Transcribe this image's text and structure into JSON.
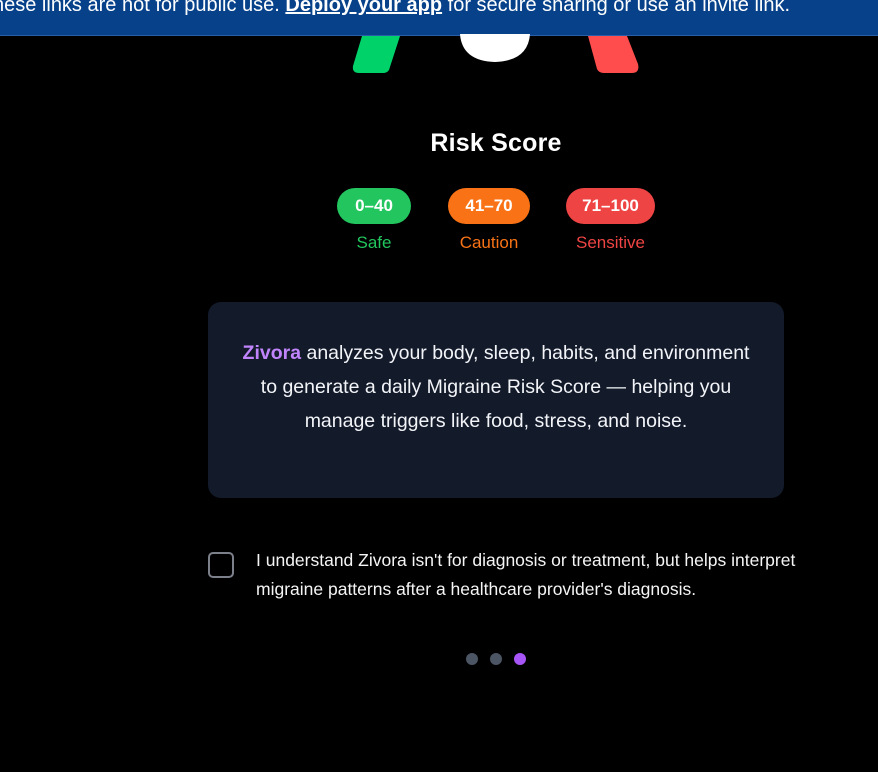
{
  "banner": {
    "text_before": "hese links are not for public use. ",
    "link_label": "Deploy your app",
    "text_after": " for secure sharing or use an invite link."
  },
  "gauge": {
    "colors": {
      "left_segment": "#00d26a",
      "center_knob": "#ffffff",
      "right_segment": "#ff4d4d"
    }
  },
  "risk": {
    "title": "Risk Score",
    "ranges": [
      {
        "range": "0–40",
        "label": "Safe",
        "color": "#22c55e",
        "label_color": "#22c55e"
      },
      {
        "range": "41–70",
        "label": "Caution",
        "color": "#f97316",
        "label_color": "#f97316"
      },
      {
        "range": "71–100",
        "label": "Sensitive",
        "color": "#ef4444",
        "label_color": "#ef4444"
      }
    ]
  },
  "info": {
    "brand": "Zivora",
    "text": " analyzes your body, sleep, habits, and environment to generate a daily Migraine Risk Score — helping you manage triggers like food, stress, and noise."
  },
  "consent": {
    "checked": false,
    "text": "I understand Zivora isn't for diagnosis or treatment, but helps interpret migraine patterns after a healthcare provider's diagnosis."
  },
  "pagination": {
    "total": 3,
    "active_index": 2,
    "colors": {
      "inactive": "#4b5563",
      "active": "#a855f7"
    }
  }
}
